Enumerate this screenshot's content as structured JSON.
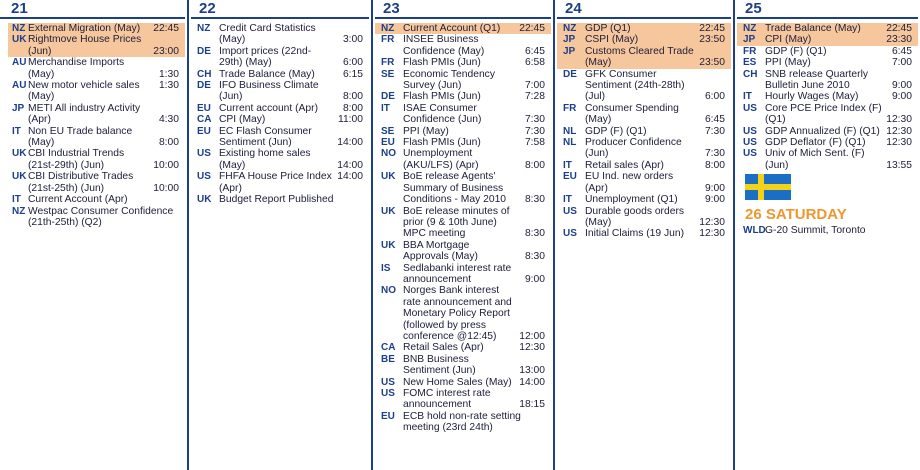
{
  "columns": [
    {
      "day": "21",
      "events": [
        {
          "cc": "NZ",
          "text": "External Migration (May)",
          "time": "22:45",
          "hl": true
        },
        {
          "cc": "UK",
          "text": "Rightmove House Prices (Jun)",
          "time": "23:00",
          "hl": true
        },
        {
          "cc": "AU",
          "text": "Merchandise Imports (May)",
          "time": "1:30"
        },
        {
          "cc": "AU",
          "text": "New motor vehicle sales (May)",
          "time": "1:30",
          "timeTop": true
        },
        {
          "cc": "JP",
          "text": "METI All industry Activity (Apr)",
          "time": "4:30"
        },
        {
          "cc": "IT",
          "text": "Non EU Trade balance (May)",
          "time": "8:00"
        },
        {
          "cc": "UK",
          "text": "CBI Industrial Trends (21st-29th) (Jun)",
          "time": "10:00"
        },
        {
          "cc": "UK",
          "text": "CBI Distributive Trades (21st-25th) (Jun)",
          "time": "10:00"
        },
        {
          "cc": "IT",
          "text": "Current Account (Apr)",
          "time": ""
        },
        {
          "cc": "NZ",
          "text": "Westpac Consumer Confidence (21th-25th) (Q2)",
          "time": ""
        }
      ]
    },
    {
      "day": "22",
      "events": [
        {
          "cc": "NZ",
          "text": "Credit Card Statistics (May)",
          "time": "3:00"
        },
        {
          "cc": "DE",
          "text": "Import prices (22nd-29th) (May)",
          "time": "6:00"
        },
        {
          "cc": "CH",
          "text": "Trade Balance (May)",
          "time": "6:15"
        },
        {
          "cc": "DE",
          "text": "IFO Business Climate (Jun)",
          "time": "8:00"
        },
        {
          "cc": "EU",
          "text": "Current account (Apr)",
          "time": "8:00"
        },
        {
          "cc": "CA",
          "text": "CPI (May)",
          "time": "11:00"
        },
        {
          "cc": "EU",
          "text": "EC Flash Consumer Sentiment (Jun)",
          "time": "14:00"
        },
        {
          "cc": "US",
          "text": "Existing home sales (May)",
          "time": "14:00"
        },
        {
          "cc": "US",
          "text": "FHFA House Price Index (Apr)",
          "time": "14:00",
          "timeTop": true
        },
        {
          "cc": "UK",
          "text": "Budget Report Published",
          "time": ""
        }
      ]
    },
    {
      "day": "23",
      "events": [
        {
          "cc": "NZ",
          "text": "Current Account (Q1)",
          "time": "22:45",
          "hl": true
        },
        {
          "cc": "FR",
          "text": "INSEE Business Confidence (May)",
          "time": "6:45"
        },
        {
          "cc": "FR",
          "text": "Flash PMIs (Jun)",
          "time": "6:58"
        },
        {
          "cc": "SE",
          "text": "Economic Tendency Survey (Jun)",
          "time": "7:00"
        },
        {
          "cc": "DE",
          "text": "Flash PMIs (Jun)",
          "time": "7:28"
        },
        {
          "cc": "IT",
          "text": "ISAE Consumer Confidence (Jun)",
          "time": "7:30"
        },
        {
          "cc": "SE",
          "text": "PPI (May)",
          "time": "7:30"
        },
        {
          "cc": "EU",
          "text": "Flash PMIs (Jun)",
          "time": "7:58"
        },
        {
          "cc": "NO",
          "text": "Unemployment (AKU/LFS) (Apr)",
          "time": "8:00"
        },
        {
          "cc": "UK",
          "text": "BoE release Agents' Summary of Business Conditions - May 2010",
          "time": "8:30"
        },
        {
          "cc": "UK",
          "text": "BoE release minutes of prior (9 & 10th June) MPC meeting",
          "time": "8:30"
        },
        {
          "cc": "UK",
          "text": "BBA Mortgage Approvals (May)",
          "time": "8:30"
        },
        {
          "cc": "IS",
          "text": "Sedlabanki interest rate announcement",
          "time": "9:00"
        },
        {
          "cc": "NO",
          "text": "Norges Bank interest rate announcement and Monetary Policy Report (followed by press conference @12:45)",
          "time": "12:00"
        },
        {
          "cc": "CA",
          "text": "Retail Sales (Apr)",
          "time": "12:30"
        },
        {
          "cc": "BE",
          "text": "BNB Business Sentiment (Jun)",
          "time": "13:00"
        },
        {
          "cc": "US",
          "text": "New Home Sales (May)",
          "time": "14:00"
        },
        {
          "cc": "US",
          "text": "FOMC interest rate announcement",
          "time": "18:15"
        },
        {
          "cc": "EU",
          "text": "ECB hold non-rate setting meeting (23rd 24th)",
          "time": ""
        }
      ]
    },
    {
      "day": "24",
      "events": [
        {
          "cc": "NZ",
          "text": "GDP (Q1)",
          "time": "22:45",
          "hl": true
        },
        {
          "cc": "JP",
          "text": "CSPI (May)",
          "time": "23:50",
          "hl": true
        },
        {
          "cc": "JP",
          "text": "Customs Cleared Trade (May)",
          "time": "23:50",
          "hl": true
        },
        {
          "cc": "DE",
          "text": "GFK Consumer Sentiment (24th-28th) (Jul)",
          "time": "6:00"
        },
        {
          "cc": "FR",
          "text": "Consumer Spending (May)",
          "time": "6:45"
        },
        {
          "cc": "NL",
          "text": "GDP (F) (Q1)",
          "time": "7:30"
        },
        {
          "cc": "NL",
          "text": "Producer Confidence (Jun)",
          "time": "7:30"
        },
        {
          "cc": "IT",
          "text": "Retail sales (Apr)",
          "time": "8:00"
        },
        {
          "cc": "EU",
          "text": "EU Ind. new orders (Apr)",
          "time": "9:00"
        },
        {
          "cc": "IT",
          "text": "Unemployment (Q1)",
          "time": "9:00"
        },
        {
          "cc": "US",
          "text": "Durable goods orders (May)",
          "time": "12:30"
        },
        {
          "cc": "US",
          "text": "Initial Claims (19 Jun)",
          "time": "12:30"
        }
      ]
    },
    {
      "day": "25",
      "events": [
        {
          "cc": "NZ",
          "text": "Trade Balance (May)",
          "time": "22:45",
          "hl": true
        },
        {
          "cc": "JP",
          "text": "CPI (May)",
          "time": "23:30",
          "hl": true
        },
        {
          "cc": "FR",
          "text": "GDP (F) (Q1)",
          "time": "6:45"
        },
        {
          "cc": "ES",
          "text": "PPI (May)",
          "time": "7:00"
        },
        {
          "cc": "CH",
          "text": "SNB release Quarterly Bulletin June 2010",
          "time": "9:00"
        },
        {
          "cc": "IT",
          "text": "Hourly Wages (May)",
          "time": "9:00"
        },
        {
          "cc": "US",
          "text": "Core PCE Price Index (F) (Q1)",
          "time": "12:30"
        },
        {
          "cc": "US",
          "text": "GDP Annualized (F) (Q1)",
          "time": "12:30"
        },
        {
          "cc": "US",
          "text": "GDP Deflator (F) (Q1)",
          "time": "12:30"
        },
        {
          "cc": "US",
          "text": "Univ of Mich Sent. (F) (Jun)",
          "time": "13:55"
        }
      ],
      "saturday": {
        "label": "26 SATURDAY",
        "events": [
          {
            "cc": "WLD",
            "text": "G-20 Summit, Toronto",
            "time": ""
          }
        ]
      }
    }
  ],
  "colors": {
    "accent": "#1c3f8a",
    "highlight": "#f6c79c",
    "saturday": "#f0962f"
  },
  "icons": {
    "flag": "sweden-flag-icon"
  }
}
